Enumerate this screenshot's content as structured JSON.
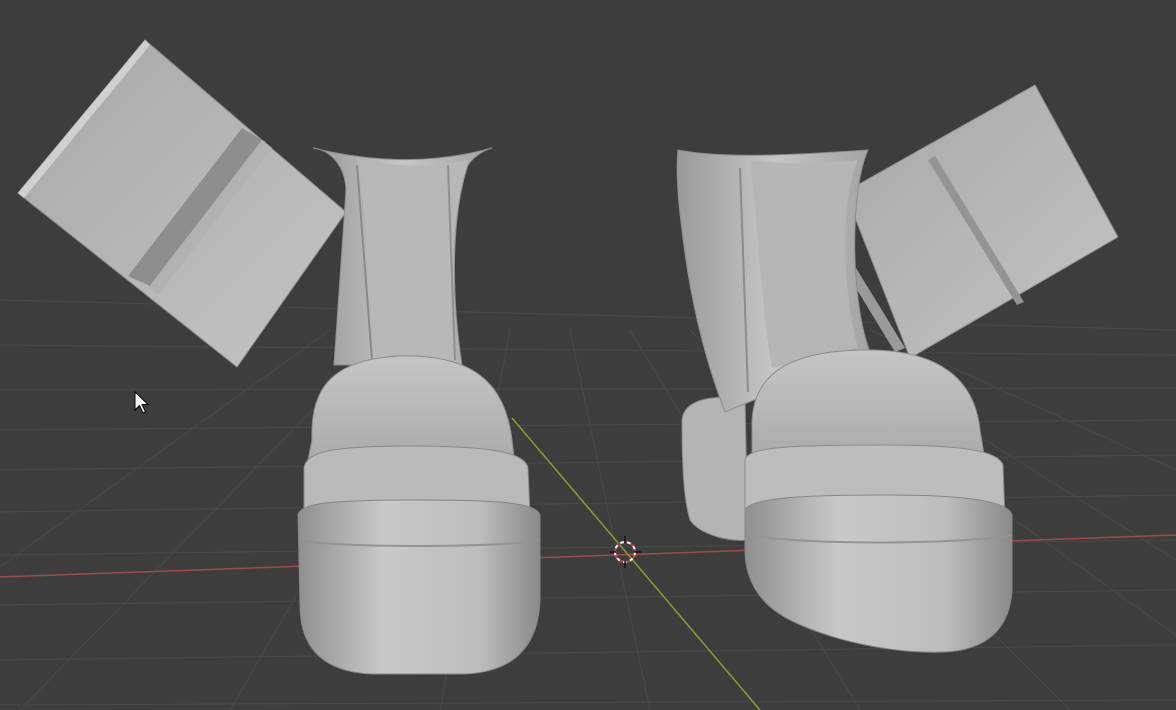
{
  "app": {
    "name": "3D viewport",
    "view": "perspective"
  },
  "viewport": {
    "background_color": "#3d3d3d",
    "grid_color": "#4a4a4a",
    "x_axis_color": "#9b4c4c",
    "y_axis_color": "#8f9a31"
  },
  "scene": {
    "objects": [
      {
        "name": "boot-left",
        "type": "mesh",
        "shading": "solid-gray"
      },
      {
        "name": "boot-right",
        "type": "mesh",
        "shading": "solid-gray"
      },
      {
        "name": "panel-left",
        "type": "mesh",
        "shading": "solid-gray"
      },
      {
        "name": "panel-right",
        "type": "mesh",
        "shading": "solid-gray"
      }
    ],
    "cursor_3d": {
      "icon": "crosshair-3d-cursor-icon"
    }
  },
  "mouse_pointer": {
    "icon": "arrow-pointer-icon"
  }
}
